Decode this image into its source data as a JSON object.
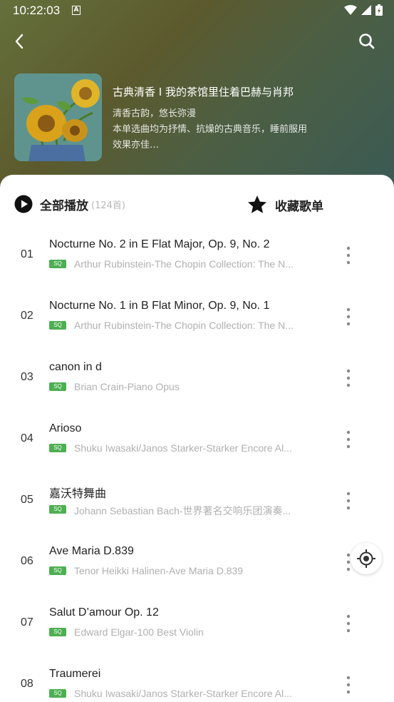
{
  "status_bar": {
    "time": "10:22:03",
    "notification_icon": "A"
  },
  "header": {
    "album_title": "古典清香 I 我的茶馆里住着巴赫与肖邦",
    "album_description": "清香古韵，悠长弥漫\n本单选曲均为抒情、抗燥的古典音乐，睡前服用效果亦佳…"
  },
  "actions": {
    "play_all_label": "全部播放",
    "play_all_count": "(124首)",
    "favorite_label": "收藏歌单"
  },
  "quality_badge": "SQ",
  "tracks": [
    {
      "num": "01",
      "title": "Nocturne No. 2 in E Flat Major, Op. 9, No. 2",
      "subtitle": "Arthur Rubinstein-The Chopin Collection: The N..."
    },
    {
      "num": "02",
      "title": "Nocturne No. 1 in B Flat Minor, Op. 9, No. 1",
      "subtitle": "Arthur Rubinstein-The Chopin Collection: The N..."
    },
    {
      "num": "03",
      "title": "canon in d",
      "subtitle": "Brian Crain-Piano Opus"
    },
    {
      "num": "04",
      "title": "Arioso",
      "subtitle": "Shuku Iwasaki/Janos Starker-Starker Encore Al..."
    },
    {
      "num": "05",
      "title": "嘉沃特舞曲",
      "subtitle": "Johann Sebastian Bach-世界著名交响乐团演奏..."
    },
    {
      "num": "06",
      "title": "Ave Maria D.839",
      "subtitle": "Tenor Heikki Halinen-Ave Maria D.839"
    },
    {
      "num": "07",
      "title": "Salut D’amour Op. 12",
      "subtitle": "Edward Elgar-100 Best Violin"
    },
    {
      "num": "08",
      "title": "Traumerei",
      "subtitle": "Shuku Iwasaki/Janos Starker-Starker Encore Al..."
    }
  ],
  "icons": {
    "back": "chevron-left-icon",
    "search": "search-icon",
    "play": "play-circle-icon",
    "favorite": "star-icon",
    "more": "more-vertical-icon",
    "locate": "locate-icon"
  },
  "colors": {
    "accent_sq": "#4caf50",
    "header_bg": "#5c5a2d"
  }
}
